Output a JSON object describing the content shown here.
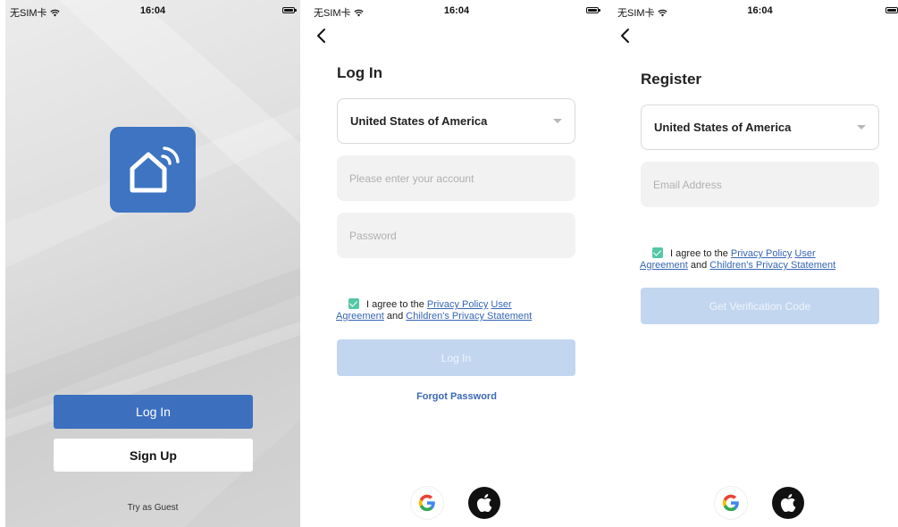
{
  "status": {
    "carrier": "无SIM卡",
    "time": "16:04"
  },
  "welcome": {
    "login_label": "Log In",
    "signup_label": "Sign Up",
    "guest_label": "Try as Guest"
  },
  "login": {
    "title": "Log In",
    "country": "United States of America",
    "account_placeholder": "Please enter your account",
    "password_placeholder": "Password",
    "agree_prefix": "I agree to the",
    "privacy_policy": "Privacy Policy",
    "user_agreement_1": "User",
    "user_agreement_2": "Agreement",
    "and": "and",
    "childrens_privacy": "Children's Privacy Statement",
    "submit_label": "Log In",
    "forgot_label": "Forgot Password"
  },
  "register": {
    "title": "Register",
    "country": "United States of America",
    "email_placeholder": "Email Address",
    "agree_prefix": "I agree to the",
    "privacy_policy": "Privacy Policy",
    "user_agreement_1": "User",
    "user_agreement_2": "Agreement",
    "and": "and",
    "childrens_privacy": "Children's Privacy Statement",
    "submit_label": "Get Verification Code"
  },
  "colors": {
    "brand_blue": "#3d6fbf",
    "link_blue": "#3666b5",
    "checkbox_green": "#55c7a6",
    "disabled_button": "#c3d6ef"
  },
  "icons": [
    "wifi-icon",
    "battery-icon",
    "smart-home-logo-icon",
    "back-chevron-icon",
    "dropdown-caret-icon",
    "checkbox-checked-icon",
    "google-icon",
    "apple-icon"
  ]
}
